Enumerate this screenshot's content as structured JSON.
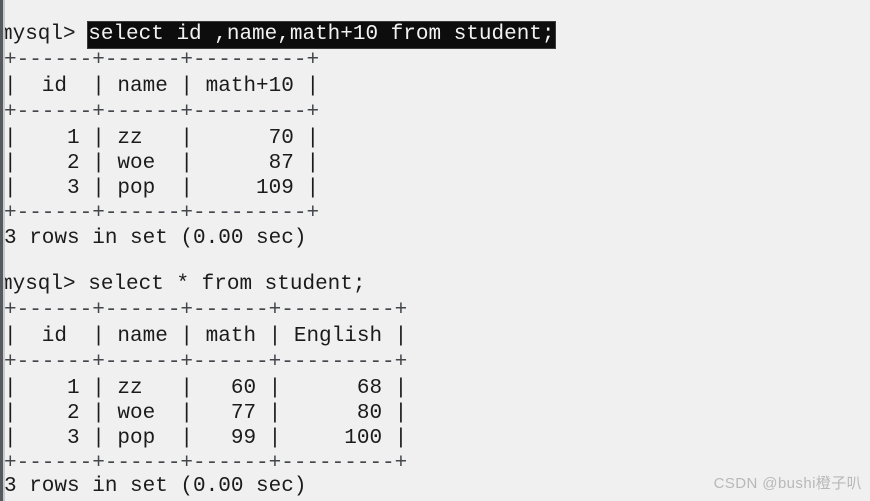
{
  "terminal": {
    "background_color": "#f0f0f0",
    "text_color": "#1b1b1b",
    "highlight_bg": "#0d0d0d",
    "highlight_fg": "#f2f2f2",
    "prompt": "mysql>",
    "blocks": [
      {
        "prompt": "mysql>",
        "command": "select id ,name,math+10 from student;",
        "command_highlighted": true,
        "table": {
          "border_top": "+------+------+---------+",
          "header_row": "|  id  | name | math+10 |",
          "border_mid": "+------+------+---------+",
          "data_rows": [
            "|    1 | zz   |      70 |",
            "|    2 | woe  |      87 |",
            "|    3 | pop  |     109 |"
          ],
          "border_bottom": "+------+------+---------+",
          "columns": [
            "id",
            "name",
            "math+10"
          ],
          "rows": [
            [
              "1",
              "zz",
              "70"
            ],
            [
              "2",
              "woe",
              "87"
            ],
            [
              "3",
              "pop",
              "109"
            ]
          ]
        },
        "status": "3 rows in set (0.00 sec)"
      },
      {
        "prompt": "mysql>",
        "command": "select * from student;",
        "command_highlighted": false,
        "table": {
          "border_top": "+------+------+------+---------+",
          "header_row": "|  id  | name | math | English |",
          "border_mid": "+------+------+------+---------+",
          "data_rows": [
            "|    1 | zz   |   60 |      68 |",
            "|    2 | woe  |   77 |      80 |",
            "|    3 | pop  |   99 |     100 |"
          ],
          "border_bottom": "+------+------+------+---------+",
          "columns": [
            "id",
            "name",
            "math",
            "English"
          ],
          "rows": [
            [
              "1",
              "zz",
              "60",
              "68"
            ],
            [
              "2",
              "woe",
              "77",
              "80"
            ],
            [
              "3",
              "pop",
              "99",
              "100"
            ]
          ]
        },
        "status": "3 rows in set (0.00 sec)"
      }
    ]
  },
  "watermark": {
    "text": "CSDN @bushi橙子叭"
  }
}
